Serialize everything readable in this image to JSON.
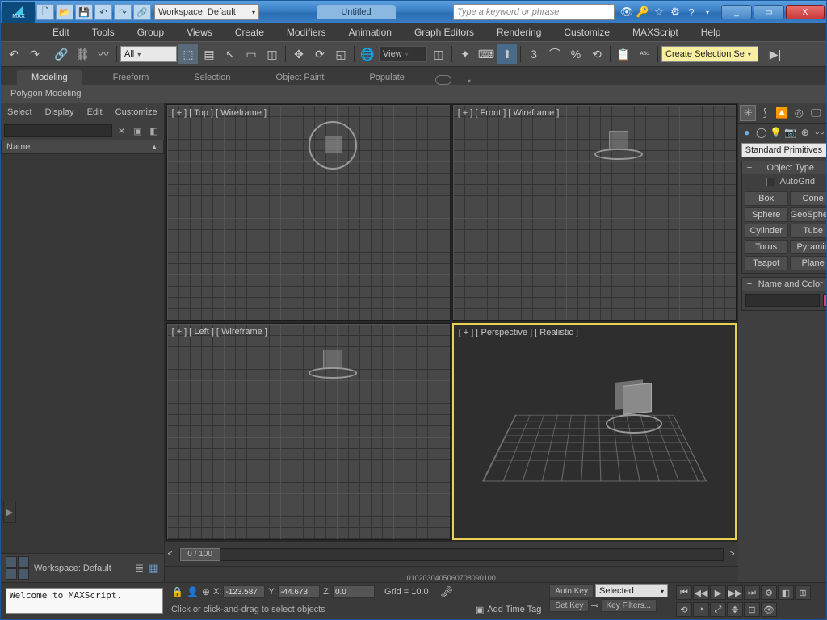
{
  "title": "Untitled",
  "logo_text": "MAX",
  "workspace_label": "Workspace: Default",
  "search_placeholder": "Type a keyword or phrase",
  "win": {
    "min": "_",
    "max": "▭",
    "close": "X"
  },
  "menu": [
    "Edit",
    "Tools",
    "Group",
    "Views",
    "Create",
    "Modifiers",
    "Animation",
    "Graph Editors",
    "Rendering",
    "Customize",
    "MAXScript",
    "Help"
  ],
  "toolbar": {
    "undo": "↶",
    "redo": "↷",
    "combo_all": "All",
    "combo_view": "View",
    "right_combo": "Create Selection Se"
  },
  "ribbon_tabs": [
    "Modeling",
    "Freeform",
    "Selection",
    "Object Paint",
    "Populate"
  ],
  "ribbon_section": "Polygon Modeling",
  "scene": {
    "menu": [
      "Select",
      "Display",
      "Edit",
      "Customize"
    ],
    "col": "Name",
    "col_arrow": "▲"
  },
  "left_workspace": "Workspace: Default",
  "vp": {
    "top": "[ + ] [ Top ] [ Wireframe ]",
    "front": "[ + ] [ Front ] [ Wireframe ]",
    "left": "[ + ] [ Left ] [ Wireframe ]",
    "persp": "[ + ] [ Perspective ] [ Realistic ]"
  },
  "create": {
    "category": "Standard Primitives",
    "cat_arrow": "▾",
    "rollout_obj": "Object Type",
    "autogrid": "AutoGrid",
    "buttons": [
      "Box",
      "Cone",
      "Sphere",
      "GeoSphere",
      "Cylinder",
      "Tube",
      "Torus",
      "Pyramid",
      "Teapot",
      "Plane"
    ],
    "rollout_name": "Name and Color"
  },
  "timeline": {
    "slider_label": "0 / 100",
    "nav_prev": "<",
    "nav_next": ">",
    "ticks": [
      "0",
      "10",
      "20",
      "30",
      "40",
      "50",
      "60",
      "70",
      "80",
      "90",
      "100"
    ]
  },
  "status": {
    "maxscript": "Welcome to MAXScript.",
    "prompt": "Click or click-and-drag to select objects",
    "x": "-123.587",
    "y": "-44.673",
    "z": "0.0",
    "grid": "Grid = 10.0",
    "addtag": "Add Time Tag",
    "autokey": "Auto Key",
    "setkey": "Set Key",
    "selected": "Selected",
    "sel_arrow": "▾",
    "keyfilters": "Key Filters...",
    "play": [
      "⏮",
      "◀◀",
      "▶",
      "▶▶",
      "⏭",
      "⚙",
      "◧",
      "⊞",
      "⟲",
      "◔",
      "⤢",
      "✥",
      "⊡",
      "👁"
    ]
  }
}
